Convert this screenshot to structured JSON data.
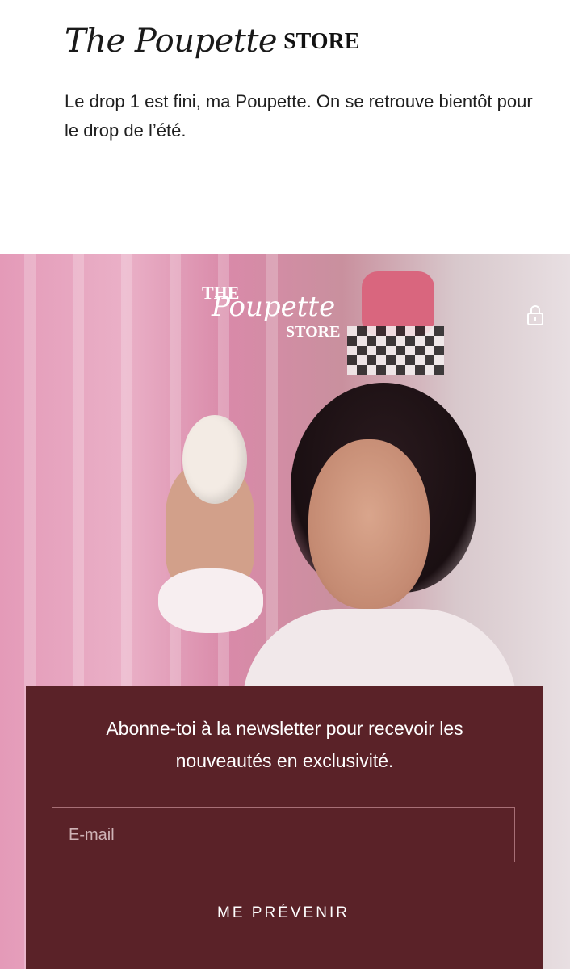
{
  "header": {
    "logo_script": "The Poupette",
    "logo_store": "STORE"
  },
  "intro": {
    "message": "Le drop 1 est fini, ma Poupette. On se retrouve bientôt pour le drop de l’été."
  },
  "hero": {
    "logo_the": "THE",
    "logo_script": "Poupette",
    "logo_store": "STORE",
    "lock_icon": "lock-icon"
  },
  "newsletter": {
    "text": "Abonne-toi à la newsletter pour recevoir les nouveautés en exclusivité.",
    "email_placeholder": "E-mail",
    "email_value": "",
    "button_label": "ME PRÉVENIR",
    "background_color": "#5a2228"
  }
}
